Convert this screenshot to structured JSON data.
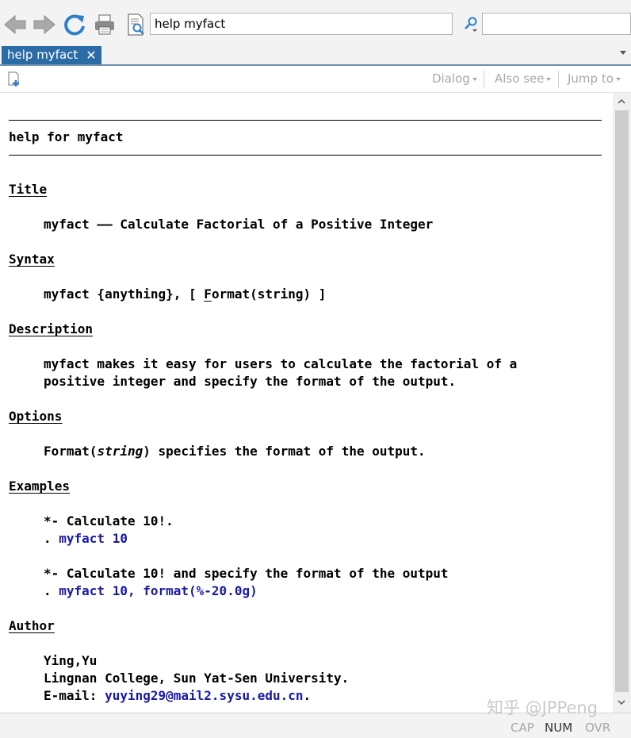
{
  "toolbar": {
    "address_value": "help myfact",
    "icons": [
      "back-arrow-icon",
      "forward-arrow-icon",
      "refresh-icon",
      "print-icon",
      "document-search-icon",
      "search-icon"
    ]
  },
  "tab": {
    "label": "help myfact",
    "close": "✕"
  },
  "toolbar2": {
    "dialog": "Dialog",
    "also_see": "Also see",
    "jump_to": "Jump to"
  },
  "help": {
    "header": "help for myfact",
    "title_heading": "Title",
    "title_cmd": "myfact",
    "title_dash": " —— ",
    "title_text": "Calculate Factorial of a Positive Integer",
    "syntax_heading": "Syntax",
    "syntax_pre": "myfact {anything}, [ ",
    "syntax_underlined": "F",
    "syntax_post": "ormat(string) ]",
    "description_heading": "Description",
    "description_line1": "myfact makes it easy for users to calculate the factorial of a",
    "description_line2": "positive integer and specify the format of the output.",
    "options_heading": "Options",
    "options_pre": "Format(",
    "options_italic": "string",
    "options_post": ") specifies the format of the output.",
    "examples_heading": "Examples",
    "example1_comment": "*- Calculate 10!.",
    "example1_dot": ". ",
    "example1_cmd": "myfact 10",
    "example2_comment": "*- Calculate 10! and specify the format of the output",
    "example2_dot": ". ",
    "example2_cmd": "myfact 10, format(%-20.0g)",
    "author_heading": "Author",
    "author_name": "Ying,Yu",
    "author_affil": "Lingnan College, Sun Yat-Sen University.",
    "author_email_label": "E-mail: ",
    "author_email": "yuying29@mail2.sysu.edu.cn",
    "author_email_end": "."
  },
  "status": {
    "cap": "CAP",
    "num": "NUM",
    "ovr": "OVR"
  },
  "watermark": "知乎 @JPPeng",
  "colors": {
    "tab": "#2b6ca6",
    "link": "#1a1aa6",
    "disabled": "#a8a8a8"
  }
}
